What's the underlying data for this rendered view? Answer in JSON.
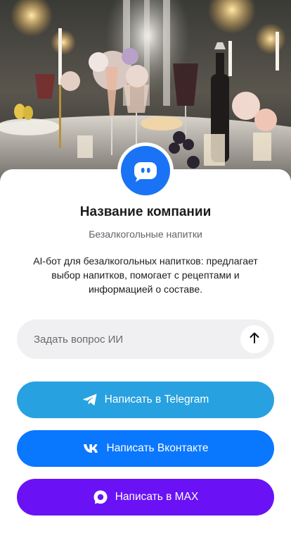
{
  "company": {
    "name": "Название компании",
    "category": "Безалкогольные напитки",
    "description": "AI-бот для безалкогольных напитков: предлагает выбор напитков, помогает с рецептами и информацией о составе."
  },
  "ask": {
    "placeholder": "Задать вопрос ИИ",
    "send_icon": "arrow-up-icon"
  },
  "buttons": {
    "telegram": {
      "label": "Написать в Telegram",
      "icon": "telegram-icon",
      "color": "#28a1e0"
    },
    "vk": {
      "label": "Написать Вконтакте",
      "icon": "vk-icon",
      "color": "#0a77ff"
    },
    "max": {
      "label": "Написать в MAX",
      "icon": "max-icon",
      "color": "#6a12f5"
    }
  },
  "avatar": {
    "icon": "chat-bot-icon",
    "color": "#1a73f5"
  }
}
